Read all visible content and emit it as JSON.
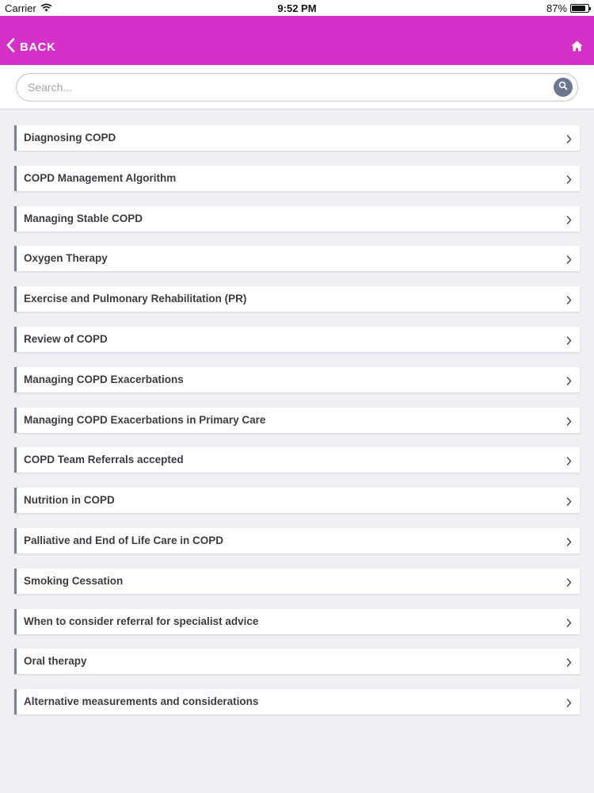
{
  "status_bar": {
    "carrier": "Carrier",
    "time": "9:52 PM",
    "battery": "87%",
    "battery_level": 0.87
  },
  "nav": {
    "back_label": "BACK",
    "color": "#d531c8"
  },
  "search": {
    "placeholder": "Search..."
  },
  "menu": {
    "items": [
      {
        "label": "Diagnosing COPD"
      },
      {
        "label": "COPD Management Algorithm"
      },
      {
        "label": "Managing Stable COPD"
      },
      {
        "label": "Oxygen Therapy"
      },
      {
        "label": "Exercise and Pulmonary Rehabilitation (PR)"
      },
      {
        "label": "Review of COPD"
      },
      {
        "label": "Managing COPD Exacerbations"
      },
      {
        "label": "Managing COPD Exacerbations in Primary Care"
      },
      {
        "label": "COPD Team Referrals accepted"
      },
      {
        "label": "Nutrition in COPD"
      },
      {
        "label": "Palliative and End of Life Care in COPD"
      },
      {
        "label": "Smoking Cessation"
      },
      {
        "label": "When to consider referral for specialist advice"
      },
      {
        "label": "Oral therapy"
      },
      {
        "label": "Alternative measurements and considerations"
      }
    ]
  },
  "icons": {
    "wifi": "wifi-icon",
    "back": "chevron-left-icon",
    "home": "home-icon",
    "search": "search-icon",
    "item_arrow": "chevron-right-icon"
  }
}
